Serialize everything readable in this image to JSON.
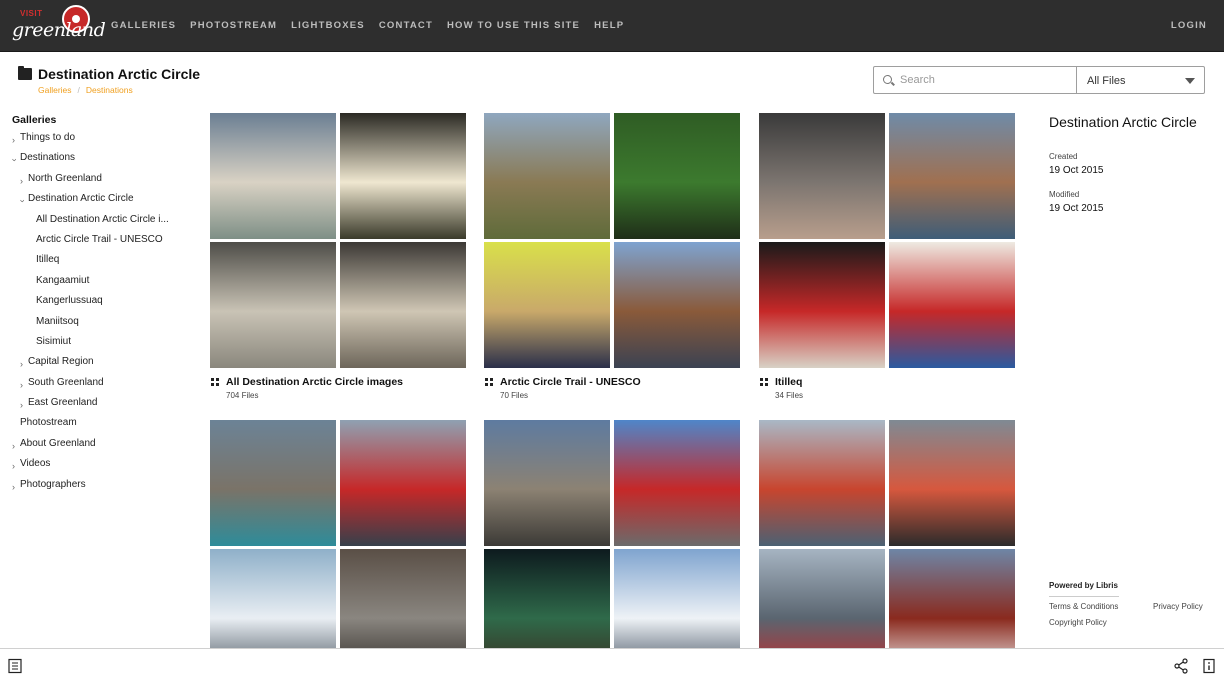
{
  "brand": {
    "visit": "VISIT",
    "name": "greenland"
  },
  "nav": {
    "items": [
      "GALLERIES",
      "PHOTOSTREAM",
      "LIGHTBOXES",
      "CONTACT",
      "HOW TO USE THIS SITE",
      "HELP"
    ],
    "login": "LOGIN"
  },
  "header": {
    "title": "Destination Arctic Circle",
    "breadcrumb": [
      "Galleries",
      "Destinations"
    ],
    "breadcrumb_sep": "/"
  },
  "search": {
    "placeholder": "Search",
    "value": ""
  },
  "filter": {
    "selected": "All Files"
  },
  "sidebar": {
    "heading": "Galleries",
    "items": [
      {
        "label": "Things to do",
        "chev": "›"
      },
      {
        "label": "Destinations",
        "chev": "‹"
      },
      {
        "label": "North Greenland",
        "chev": "›"
      },
      {
        "label": "Destination Arctic Circle",
        "chev": "‹"
      },
      {
        "label": "All Destination Arctic Circle i...",
        "chev": ""
      },
      {
        "label": "Arctic Circle Trail - UNESCO",
        "chev": ""
      },
      {
        "label": "Itilleq",
        "chev": ""
      },
      {
        "label": "Kangaamiut",
        "chev": ""
      },
      {
        "label": "Kangerlussuaq",
        "chev": ""
      },
      {
        "label": "Maniitsoq",
        "chev": ""
      },
      {
        "label": "Sisimiut",
        "chev": ""
      },
      {
        "label": "Capital Region",
        "chev": "›"
      },
      {
        "label": "South Greenland",
        "chev": "›"
      },
      {
        "label": "East Greenland",
        "chev": "›"
      },
      {
        "label": "Photostream",
        "chev": ""
      },
      {
        "label": "About Greenland",
        "chev": "›"
      },
      {
        "label": "Videos",
        "chev": "›"
      },
      {
        "label": "Photographers",
        "chev": "›"
      }
    ]
  },
  "galleries": [
    {
      "title": "All Destination Arctic Circle images",
      "count": "704 Files"
    },
    {
      "title": "Arctic Circle Trail - UNESCO",
      "count": "70 Files"
    },
    {
      "title": "Itilleq",
      "count": "34 Files"
    },
    {
      "title": "",
      "count": ""
    },
    {
      "title": "",
      "count": ""
    },
    {
      "title": "",
      "count": ""
    }
  ],
  "info": {
    "title": "Destination Arctic Circle",
    "created_label": "Created",
    "created": "19 Oct 2015",
    "modified_label": "Modified",
    "modified": "19 Oct 2015"
  },
  "footer": {
    "powered": "Powered by Libris",
    "terms": "Terms & Conditions",
    "privacy": "Privacy Policy",
    "copyright": "Copyright Policy"
  },
  "icons": [
    "folder-icon",
    "search-icon",
    "caret-down-icon",
    "grid-icon",
    "list-icon",
    "share-icon",
    "info-icon"
  ]
}
